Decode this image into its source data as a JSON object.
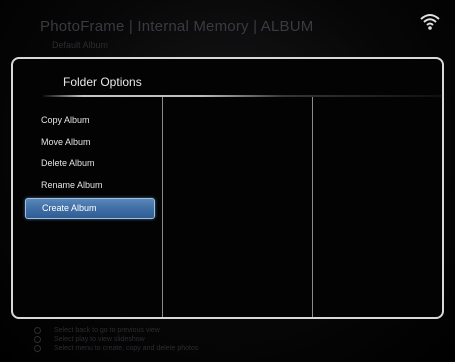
{
  "header": {
    "title": "PhotoFrame | Internal Memory | ALBUM",
    "subtitle": "Default Album",
    "status_icon": "wifi-icon"
  },
  "dialog": {
    "title": "Folder Options",
    "menu": [
      {
        "label": "Copy Album",
        "selected": false
      },
      {
        "label": "Move Album",
        "selected": false
      },
      {
        "label": "Delete Album",
        "selected": false
      },
      {
        "label": "Rename Album",
        "selected": false
      },
      {
        "label": "Create Album",
        "selected": true
      }
    ]
  },
  "footer": {
    "hints": [
      {
        "icon": "back-button-icon",
        "text": "Select back to go to previous view"
      },
      {
        "icon": "play-button-icon",
        "text": "Select play to view slideshow"
      },
      {
        "icon": "menu-button-icon",
        "text": "Select menu to create, copy and delete photos"
      }
    ]
  },
  "colors": {
    "selection": "#3f6fa6",
    "selection_border": "#9cc0e6",
    "panel_border": "#d8d8d8",
    "dim_text": "#3a3a40"
  }
}
